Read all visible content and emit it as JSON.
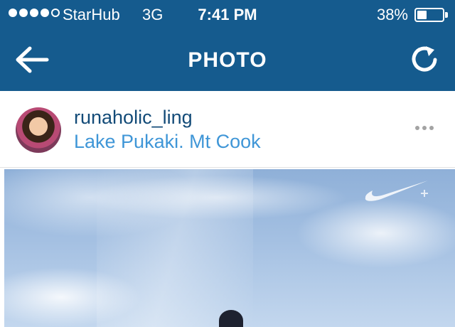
{
  "status_bar": {
    "signal_bars_filled": 4,
    "signal_bars_total": 5,
    "carrier": "StarHub",
    "network": "3G",
    "time": "7:41 PM",
    "battery_percent_text": "38%",
    "battery_level": 0.38
  },
  "nav": {
    "title": "PHOTO",
    "back_icon": "back-arrow-icon",
    "refresh_icon": "refresh-icon"
  },
  "post": {
    "username": "runaholic_ling",
    "location": "Lake Pukaki.  Mt Cook",
    "more_icon": "more-options-icon"
  },
  "colors": {
    "header_bg": "#155b8e",
    "username": "#134b78",
    "location": "#3f96d7"
  }
}
